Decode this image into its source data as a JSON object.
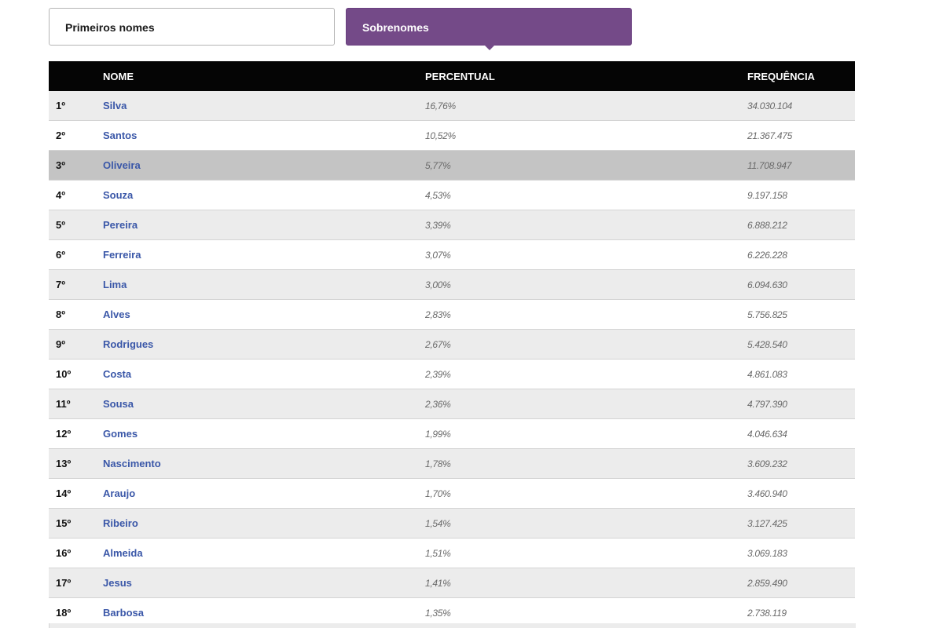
{
  "tabs": {
    "first_names_label": "Primeiros nomes",
    "surnames_label": "Sobrenomes",
    "active": "Sobrenomes"
  },
  "table": {
    "columns": [
      "",
      "NOME",
      "PERCENTUAL",
      "FREQUÊNCIA"
    ],
    "rows": [
      {
        "rank": "1º",
        "name": "Silva",
        "percent": "16,76%",
        "frequency": "34.030.104"
      },
      {
        "rank": "2º",
        "name": "Santos",
        "percent": "10,52%",
        "frequency": "21.367.475"
      },
      {
        "rank": "3º",
        "name": "Oliveira",
        "percent": "5,77%",
        "frequency": "11.708.947"
      },
      {
        "rank": "4º",
        "name": "Souza",
        "percent": "4,53%",
        "frequency": "9.197.158"
      },
      {
        "rank": "5º",
        "name": "Pereira",
        "percent": "3,39%",
        "frequency": "6.888.212"
      },
      {
        "rank": "6º",
        "name": "Ferreira",
        "percent": "3,07%",
        "frequency": "6.226.228"
      },
      {
        "rank": "7º",
        "name": "Lima",
        "percent": "3,00%",
        "frequency": "6.094.630"
      },
      {
        "rank": "8º",
        "name": "Alves",
        "percent": "2,83%",
        "frequency": "5.756.825"
      },
      {
        "rank": "9º",
        "name": "Rodrigues",
        "percent": "2,67%",
        "frequency": "5.428.540"
      },
      {
        "rank": "10º",
        "name": "Costa",
        "percent": "2,39%",
        "frequency": "4.861.083"
      },
      {
        "rank": "11º",
        "name": "Sousa",
        "percent": "2,36%",
        "frequency": "4.797.390"
      },
      {
        "rank": "12º",
        "name": "Gomes",
        "percent": "1,99%",
        "frequency": "4.046.634"
      },
      {
        "rank": "13º",
        "name": "Nascimento",
        "percent": "1,78%",
        "frequency": "3.609.232"
      },
      {
        "rank": "14º",
        "name": "Araujo",
        "percent": "1,70%",
        "frequency": "3.460.940"
      },
      {
        "rank": "15º",
        "name": "Ribeiro",
        "percent": "1,54%",
        "frequency": "3.127.425"
      },
      {
        "rank": "16º",
        "name": "Almeida",
        "percent": "1,51%",
        "frequency": "3.069.183"
      },
      {
        "rank": "17º",
        "name": "Jesus",
        "percent": "1,41%",
        "frequency": "2.859.490"
      },
      {
        "rank": "18º",
        "name": "Barbosa",
        "percent": "1,35%",
        "frequency": "2.738.119"
      }
    ],
    "highlighted_row": "3º"
  },
  "colors": {
    "active_tab": "#744a88",
    "header_bg": "#050505",
    "name_link": "#3a57a8",
    "highlight_row": "#c4c4c4",
    "stripe": "#ececec"
  }
}
